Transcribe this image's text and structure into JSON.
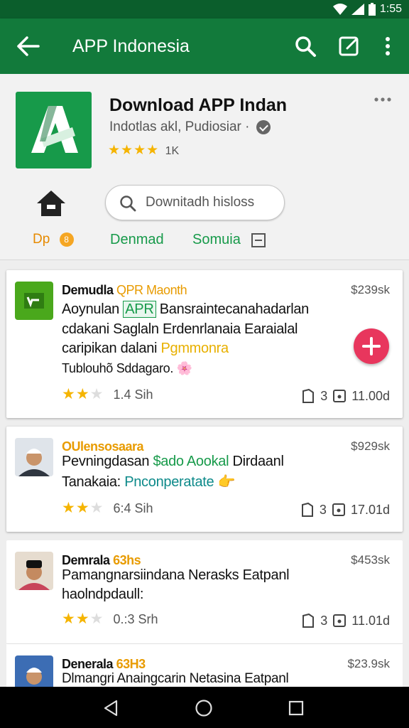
{
  "status_bar": {
    "time": "1:55"
  },
  "app_bar": {
    "title": "APP Indonesia"
  },
  "app": {
    "name": "Download APP Indan",
    "developer": "Indotlas akl, Pudiosiar ·",
    "stars": "★★★★",
    "rating_count": "1K"
  },
  "search": {
    "placeholder": "Downitadh hisloss"
  },
  "tabs": [
    {
      "label": "Dp",
      "badge": "8"
    },
    {
      "label": "Denmad"
    },
    {
      "label": "Somuia"
    }
  ],
  "cards": [
    {
      "title": "Demudla",
      "tag": "QPR Maonth",
      "price": "$239sk",
      "line1_pre": "Aoynulan",
      "line1_hl": "APR",
      "line1_post": "Bansraintecanahadarlan",
      "line2": "cdakani Saglaln Erdenrlanaia Earaialal",
      "line3_pre": "caripikan dalani",
      "line3_hl": "Pgmmonra",
      "line4": "Tublouhõ Sddagaro.",
      "rating": "1.4 Sih",
      "stat1": "3",
      "stat2": "11.00d"
    },
    {
      "title": "OUlensosaara",
      "price": "$929sk",
      "line1_pre": "Pevningdasan",
      "line1_hl": "$ado Aookal",
      "line1_post": "Dirdaanl",
      "line2_pre": "Tanakaia:",
      "line2_hl": "Pnconperatate",
      "rating": "6:4 Sih",
      "stat1": "3",
      "stat2": "17.01d"
    },
    {
      "title": "Demrala",
      "tag": "63hs",
      "price": "$453sk",
      "line1": "Pamangnarsiindana Nerasks Eatpanl",
      "line2": "haolndpdaull:",
      "rating": "0.:3 Srh",
      "stat1": "3",
      "stat2": "11.01d"
    },
    {
      "title": "Denerala",
      "tag": "63H3",
      "price": "$23.9sk",
      "line1": "Dlmangri Anaingcarin Netasina Eatpanl"
    }
  ],
  "colors": {
    "primary": "#127a3b",
    "status": "#0b5e2c",
    "accent": "#f5b400",
    "fab": "#e8365d"
  }
}
